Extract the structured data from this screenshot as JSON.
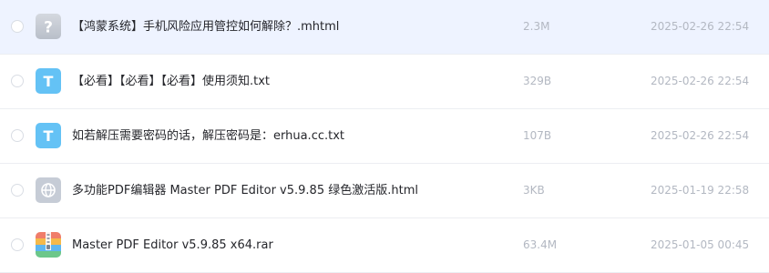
{
  "files": [
    {
      "name": "【鸿蒙系统】手机风险应用管控如何解除？.mhtml",
      "size": "2.3M",
      "date": "2025-02-26 22:54",
      "icon": "unknown-file-icon",
      "selected": true
    },
    {
      "name": "【必看】【必看】【必看】使用须知.txt",
      "size": "329B",
      "date": "2025-02-26 22:54",
      "icon": "txt-file-icon",
      "icon_letter": "T"
    },
    {
      "name": "如若解压需要密码的话，解压密码是：erhua.cc.txt",
      "size": "107B",
      "date": "2025-02-26 22:54",
      "icon": "txt-file-icon",
      "icon_letter": "T"
    },
    {
      "name": "多功能PDF编辑器 Master PDF Editor v5.9.85 绿色激活版.html",
      "size": "3KB",
      "date": "2025-01-19 22:58",
      "icon": "web-file-icon"
    },
    {
      "name": "Master PDF Editor v5.9.85 x64.rar",
      "size": "63.4M",
      "date": "2025-01-05 00:45",
      "icon": "archive-file-icon"
    }
  ],
  "colors": {
    "selected_row_bg": "#eef3ff",
    "txt_icon": "#64c2f5",
    "meta_text": "#b3b8c2"
  }
}
